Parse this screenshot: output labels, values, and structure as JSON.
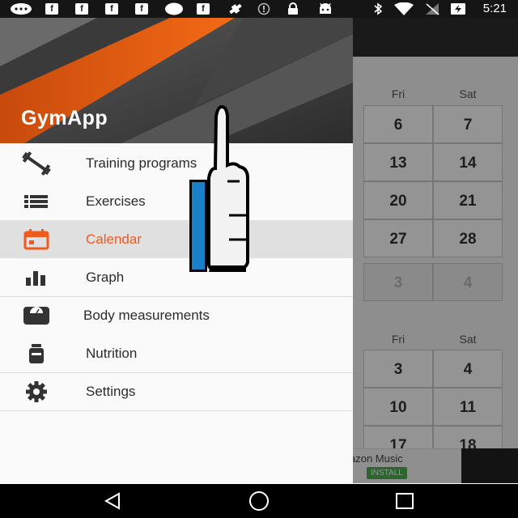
{
  "status_bar": {
    "time": "5:21",
    "left_icons": [
      "notification-icon",
      "facebook-icon",
      "facebook-icon",
      "facebook-icon",
      "facebook-icon",
      "circle-icon",
      "facebook-icon",
      "satellite-icon",
      "copyright-icon",
      "lock-icon",
      "android-icon"
    ],
    "right_icons": [
      "bluetooth-icon",
      "wifi-icon",
      "no-signal-icon",
      "battery-charging-icon"
    ],
    "facebook_glyph": "f"
  },
  "drawer": {
    "app_name": "GymApp",
    "items": [
      {
        "label": "Training programs",
        "icon": "dumbbell-icon",
        "selected": false
      },
      {
        "label": "Exercises",
        "icon": "list-icon",
        "selected": false
      },
      {
        "label": "Calendar",
        "icon": "calendar-icon",
        "selected": true
      },
      {
        "label": "Graph",
        "icon": "bar-chart-icon",
        "selected": false
      },
      {
        "label": "Body measurements",
        "icon": "scale-icon",
        "selected": false
      },
      {
        "label": "Nutrition",
        "icon": "jar-icon",
        "selected": false
      },
      {
        "label": "Settings",
        "icon": "gear-icon",
        "selected": false
      }
    ]
  },
  "calendar": {
    "month1": {
      "day_headers": [
        "Fri",
        "Sat"
      ],
      "rows": [
        [
          "6",
          "7"
        ],
        [
          "13",
          "14"
        ],
        [
          "20",
          "21"
        ],
        [
          "27",
          "28"
        ],
        [
          "3",
          "4"
        ]
      ]
    },
    "month2": {
      "day_headers": [
        "Fri",
        "Sat"
      ],
      "rows": [
        [
          "3",
          "4"
        ],
        [
          "10",
          "11"
        ],
        [
          "17",
          "18"
        ]
      ]
    }
  },
  "ad": {
    "title": "azon Music",
    "install": "INSTALL"
  },
  "colors": {
    "accent": "#ef5a1f",
    "selected_bg": "#e0e0e0",
    "hand_sleeve": "#1a80c8"
  },
  "nav_bar": {
    "buttons": [
      "back-icon",
      "home-icon",
      "recents-icon"
    ]
  }
}
